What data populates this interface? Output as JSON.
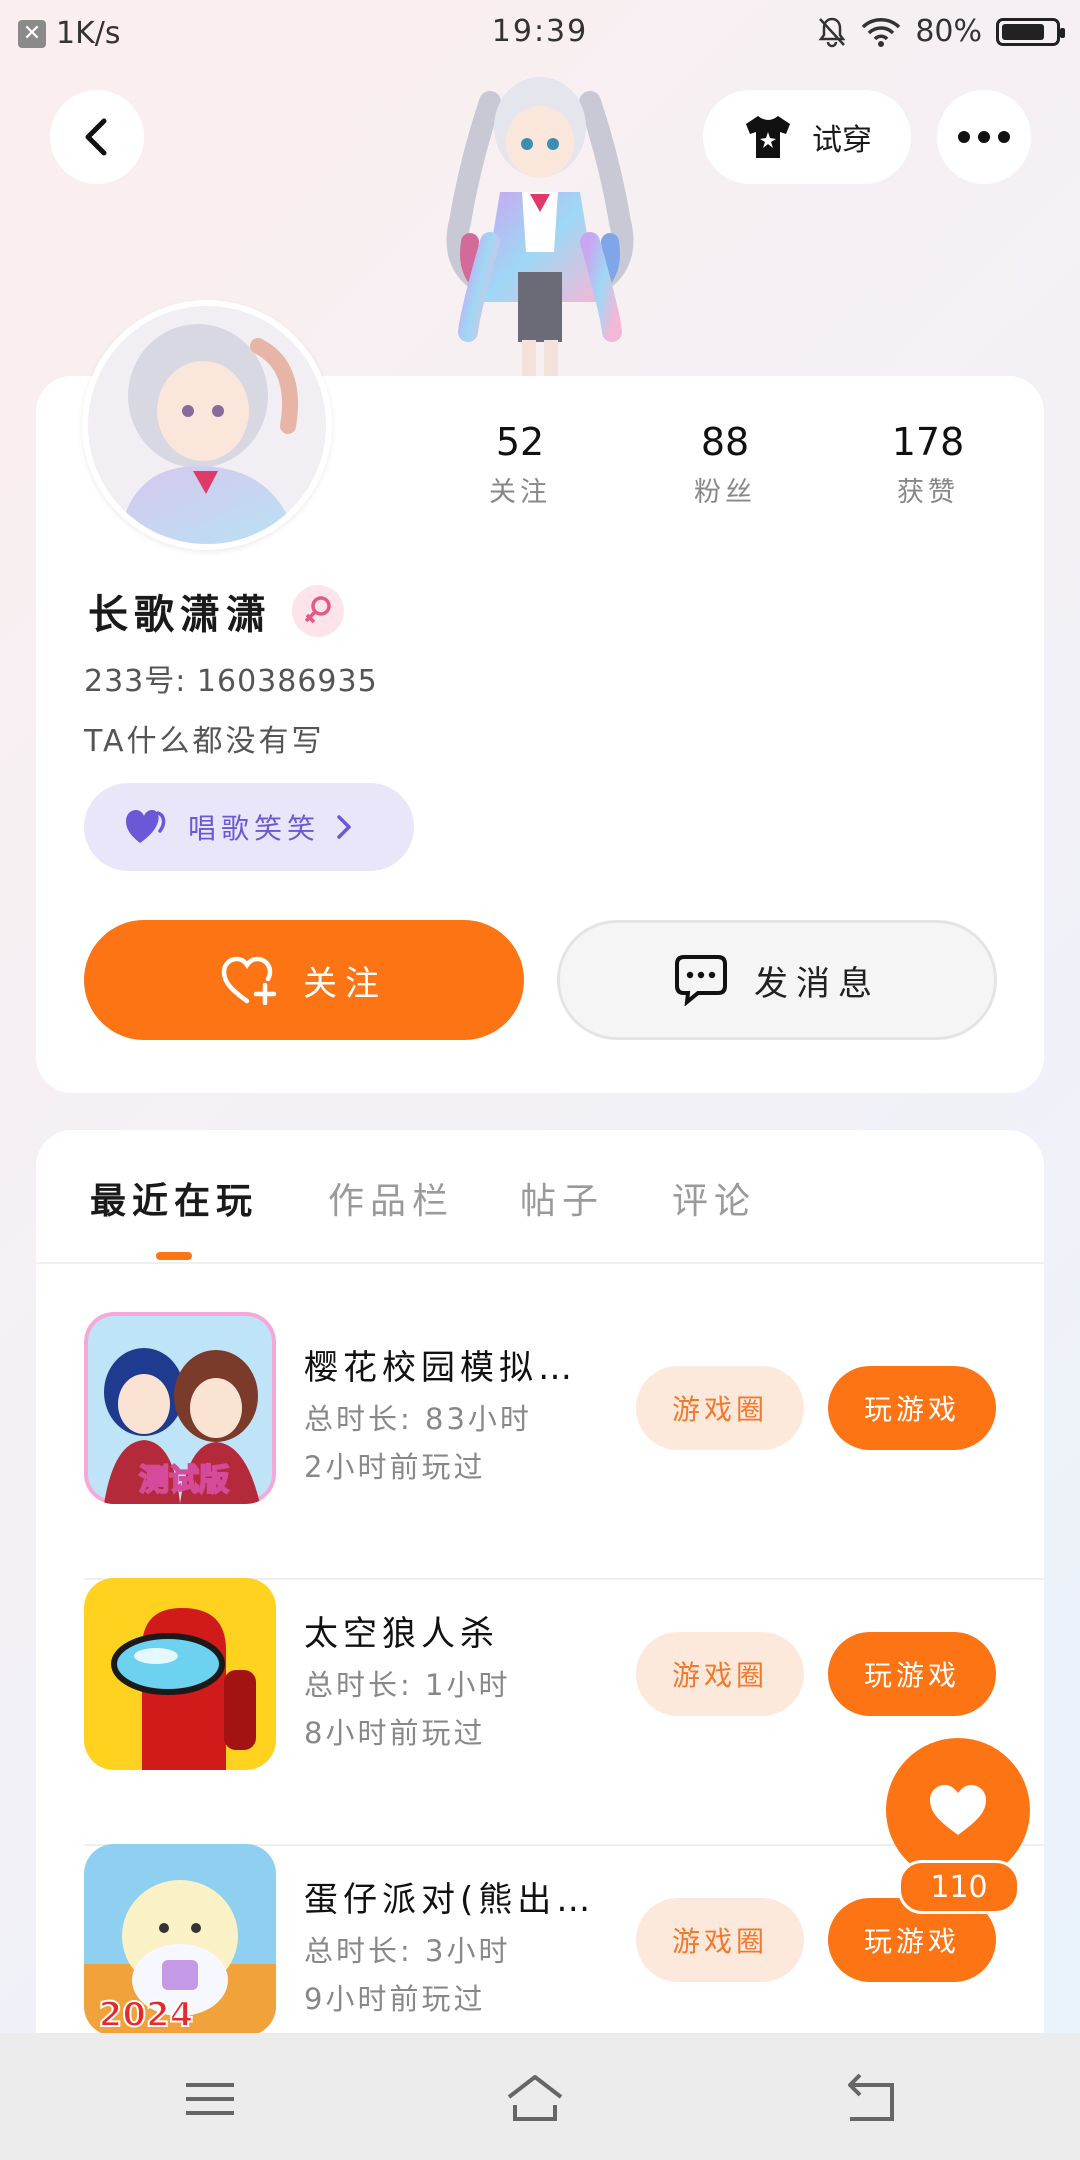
{
  "status_bar": {
    "speed": "1K/s",
    "time": "19:39",
    "battery": "80%",
    "battery_level": 0.8
  },
  "header": {
    "tryon_label": "试穿"
  },
  "profile": {
    "stats": [
      {
        "value": "52",
        "label": "关注"
      },
      {
        "value": "88",
        "label": "粉丝"
      },
      {
        "value": "178",
        "label": "获赞"
      }
    ],
    "nickname": "长歌潇潇",
    "gender": "female",
    "uid": "233号: 160386935",
    "bio": "TA什么都没有写",
    "tag": "唱歌笑笑",
    "follow_label": "关注",
    "message_label": "发消息"
  },
  "tabs": [
    "最近在玩",
    "作品栏",
    "帖子",
    "评论"
  ],
  "games": [
    {
      "name": "樱花校园模拟…",
      "total_time": "总时长: 83小时",
      "last_played": "2小时前玩过",
      "icon_badge": "测试版",
      "circle_label": "游戏圈",
      "play_label": "玩游戏"
    },
    {
      "name": "太空狼人杀",
      "total_time": "总时长: 1小时",
      "last_played": "8小时前玩过",
      "circle_label": "游戏圈",
      "play_label": "玩游戏"
    },
    {
      "name": "蛋仔派对(熊出…",
      "total_time": "总时长: 3小时",
      "last_played": "9小时前玩过",
      "icon_badge": "2024",
      "circle_label": "游戏圈",
      "play_label": "玩游戏"
    }
  ],
  "likes": {
    "count": "110"
  },
  "colors": {
    "accent": "#fd7414",
    "tag_bg": "#e9e6f9",
    "tag_text": "#6b58d6"
  }
}
